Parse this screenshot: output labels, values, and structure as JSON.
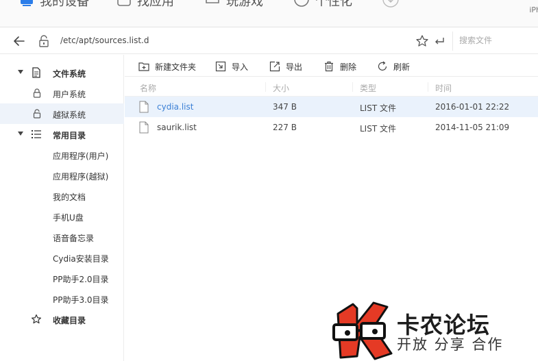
{
  "topnav": {
    "items": [
      {
        "label": "我的设备",
        "icon": "device-icon"
      },
      {
        "label": "找应用",
        "icon": "bag-icon"
      },
      {
        "label": "玩游戏",
        "icon": "gamepad-icon"
      },
      {
        "label": "个性化",
        "icon": "personal-icon"
      },
      {
        "label": "",
        "icon": "download-icon"
      }
    ],
    "device_name": "iPh",
    "accent": "#2b7de9"
  },
  "addressbar": {
    "path": "/etc/apt/sources.list.d",
    "search_placeholder": "搜索文件"
  },
  "sidebar": {
    "groups": [
      {
        "label": "文件系统",
        "icon": "document-icon",
        "expanded": true,
        "items": [
          {
            "label": "用户系统",
            "icon": "lock-icon",
            "selected": false
          },
          {
            "label": "越狱系统",
            "icon": "unlock-icon",
            "selected": true
          }
        ]
      },
      {
        "label": "常用目录",
        "icon": "list-icon",
        "expanded": true,
        "items": [
          {
            "label": "应用程序(用户)"
          },
          {
            "label": "应用程序(越狱)"
          },
          {
            "label": "我的文档"
          },
          {
            "label": "手机U盘"
          },
          {
            "label": "语音备忘录"
          },
          {
            "label": "Cydia安装目录"
          },
          {
            "label": "PP助手2.0目录"
          },
          {
            "label": "PP助手3.0目录"
          }
        ]
      },
      {
        "label": "收藏目录",
        "icon": "star-icon",
        "expanded": false,
        "items": []
      }
    ]
  },
  "toolbar": {
    "new_folder": "新建文件夹",
    "import": "导入",
    "export": "导出",
    "delete": "删除",
    "refresh": "刷新"
  },
  "table": {
    "columns": [
      "名称",
      "大小",
      "类型",
      "时间"
    ],
    "rows": [
      {
        "name": "cydia.list",
        "size": "347 B",
        "type": "LIST 文件",
        "time": "2016-01-01 22:22",
        "selected": true
      },
      {
        "name": "saurik.list",
        "size": "227 B",
        "type": "LIST 文件",
        "time": "2014-11-05 21:09",
        "selected": false
      }
    ]
  },
  "watermark": {
    "title": "卡农论坛",
    "subtitle": "开放 分享 合作",
    "brand_color": "#e53a25"
  }
}
